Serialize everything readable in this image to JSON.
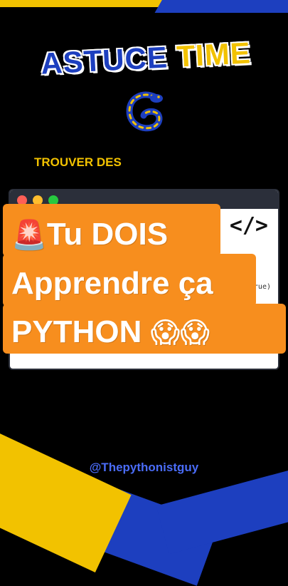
{
  "title": {
    "word1": "ASTUCE",
    "word2": "TIME"
  },
  "logo": {
    "icon": "python-snake-icon"
  },
  "subtitle": "TROUVER DES",
  "code_window": {
    "icon": "</>",
    "snippet": "ve=True)"
  },
  "headline": {
    "line1_emoji": "🚨",
    "line1": "Tu DOIS",
    "line2": "Apprendre ça",
    "line3": "PYTHON",
    "line3_emoji": "😱😱"
  },
  "handle": "@Thepythonistguy",
  "colors": {
    "background": "#000000",
    "yellow": "#f2c200",
    "blue": "#1d3fbf",
    "orange": "#f78e1e"
  }
}
